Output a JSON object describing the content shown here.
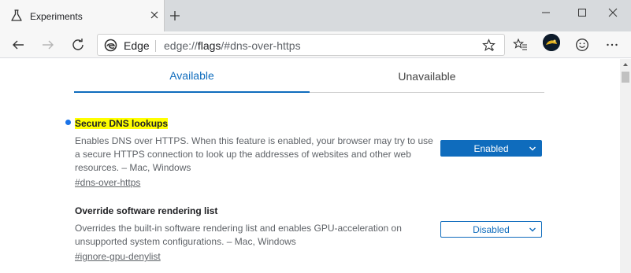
{
  "tab": {
    "title": "Experiments",
    "icon": "beaker-icon"
  },
  "address_bar": {
    "site_label": "Edge",
    "url_prefix": "edge://",
    "url_bold": "flags",
    "url_suffix": "/#dns-over-https"
  },
  "flag_tabs": [
    {
      "label": "Available",
      "active": true
    },
    {
      "label": "Unavailable",
      "active": false
    }
  ],
  "experiments": [
    {
      "title": "Secure DNS lookups",
      "highlighted": true,
      "description": "Enables DNS over HTTPS. When this feature is enabled, your browser may try to use a secure HTTPS connection to look up the addresses of websites and other web resources. – Mac, Windows",
      "link": "#dns-over-https",
      "state": "Enabled"
    },
    {
      "title": "Override software rendering list",
      "highlighted": false,
      "description": "Overrides the built-in software rendering list and enables GPU-acceleration on unsupported system configurations. – Mac, Windows",
      "link": "#ignore-gpu-denylist",
      "state": "Disabled"
    }
  ],
  "colors": {
    "accent": "#0f6cbd",
    "highlight": "#ffff00",
    "modified_dot": "#1a73e8"
  }
}
